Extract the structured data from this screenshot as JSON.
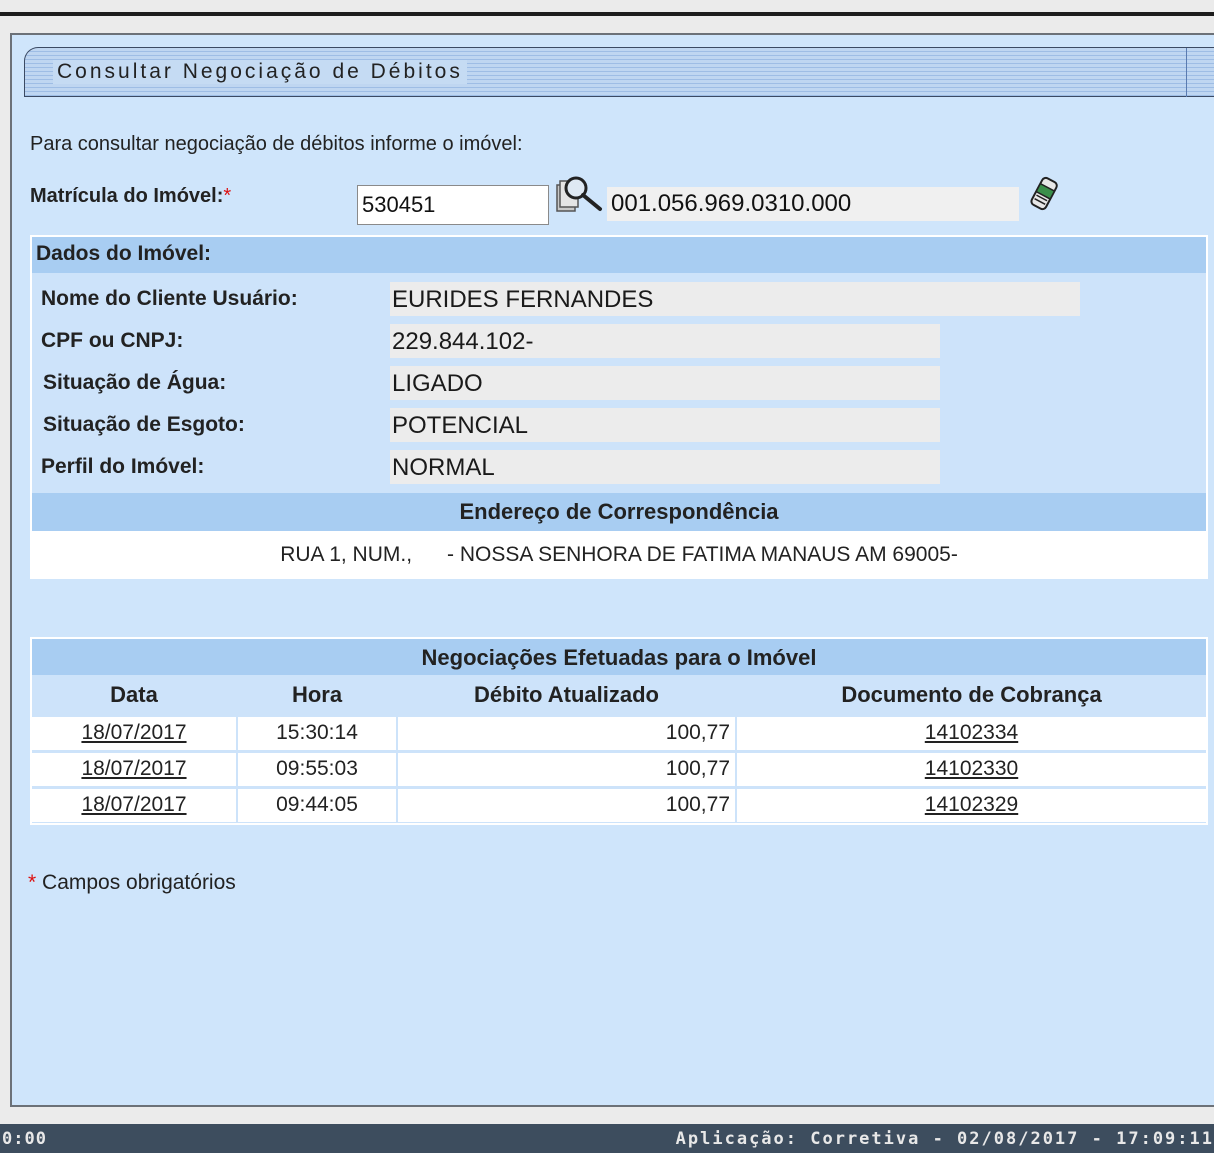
{
  "header": {
    "title": "Consultar Negociação de Débitos"
  },
  "form": {
    "instruction": "Para consultar negociação de débitos informe o imóvel:",
    "matricula_label": "Matrícula do Imóvel:",
    "required_mark": "*",
    "matricula_value": "530451",
    "inscricao_value": "001.056.969.0310.000"
  },
  "dados": {
    "section_title": "Dados do Imóvel:",
    "fields": [
      {
        "label": "Nome do Cliente Usuário:",
        "value": "EURIDES FERNANDES"
      },
      {
        "label": "CPF ou CNPJ:",
        "value": "229.844.102-"
      },
      {
        "label": "Situação de Água:",
        "value": "LIGADO"
      },
      {
        "label": "Situação de Esgoto:",
        "value": "POTENCIAL"
      },
      {
        "label": "Perfil do Imóvel:",
        "value": "NORMAL"
      }
    ],
    "endereco_title": "Endereço de Correspondência",
    "endereco_value": "RUA 1, NUM.,      - NOSSA SENHORA DE FATIMA MANAUS AM 69005-"
  },
  "negociacoes": {
    "title": "Negociações Efetuadas para o Imóvel",
    "columns": [
      "Data",
      "Hora",
      "Débito Atualizado",
      "Documento de Cobrança"
    ],
    "rows": [
      {
        "data": "18/07/2017",
        "hora": "15:30:14",
        "debito": "100,77",
        "documento": "14102334"
      },
      {
        "data": "18/07/2017",
        "hora": "09:55:03",
        "debito": "100,77",
        "documento": "14102330"
      },
      {
        "data": "18/07/2017",
        "hora": "09:44:05",
        "debito": "100,77",
        "documento": "14102329"
      }
    ]
  },
  "footnote": {
    "mark": "*",
    "text": " Campos obrigatórios"
  },
  "status_bar": {
    "left_text": "0:00",
    "right_text": "Aplicação: Corretiva - 02/08/2017 - 17:09:11"
  },
  "colors": {
    "panel_bg": "#cfe5fb",
    "section_header": "#a8cdf2",
    "status_bar": "#3d4d5e",
    "required": "#dd1111"
  }
}
